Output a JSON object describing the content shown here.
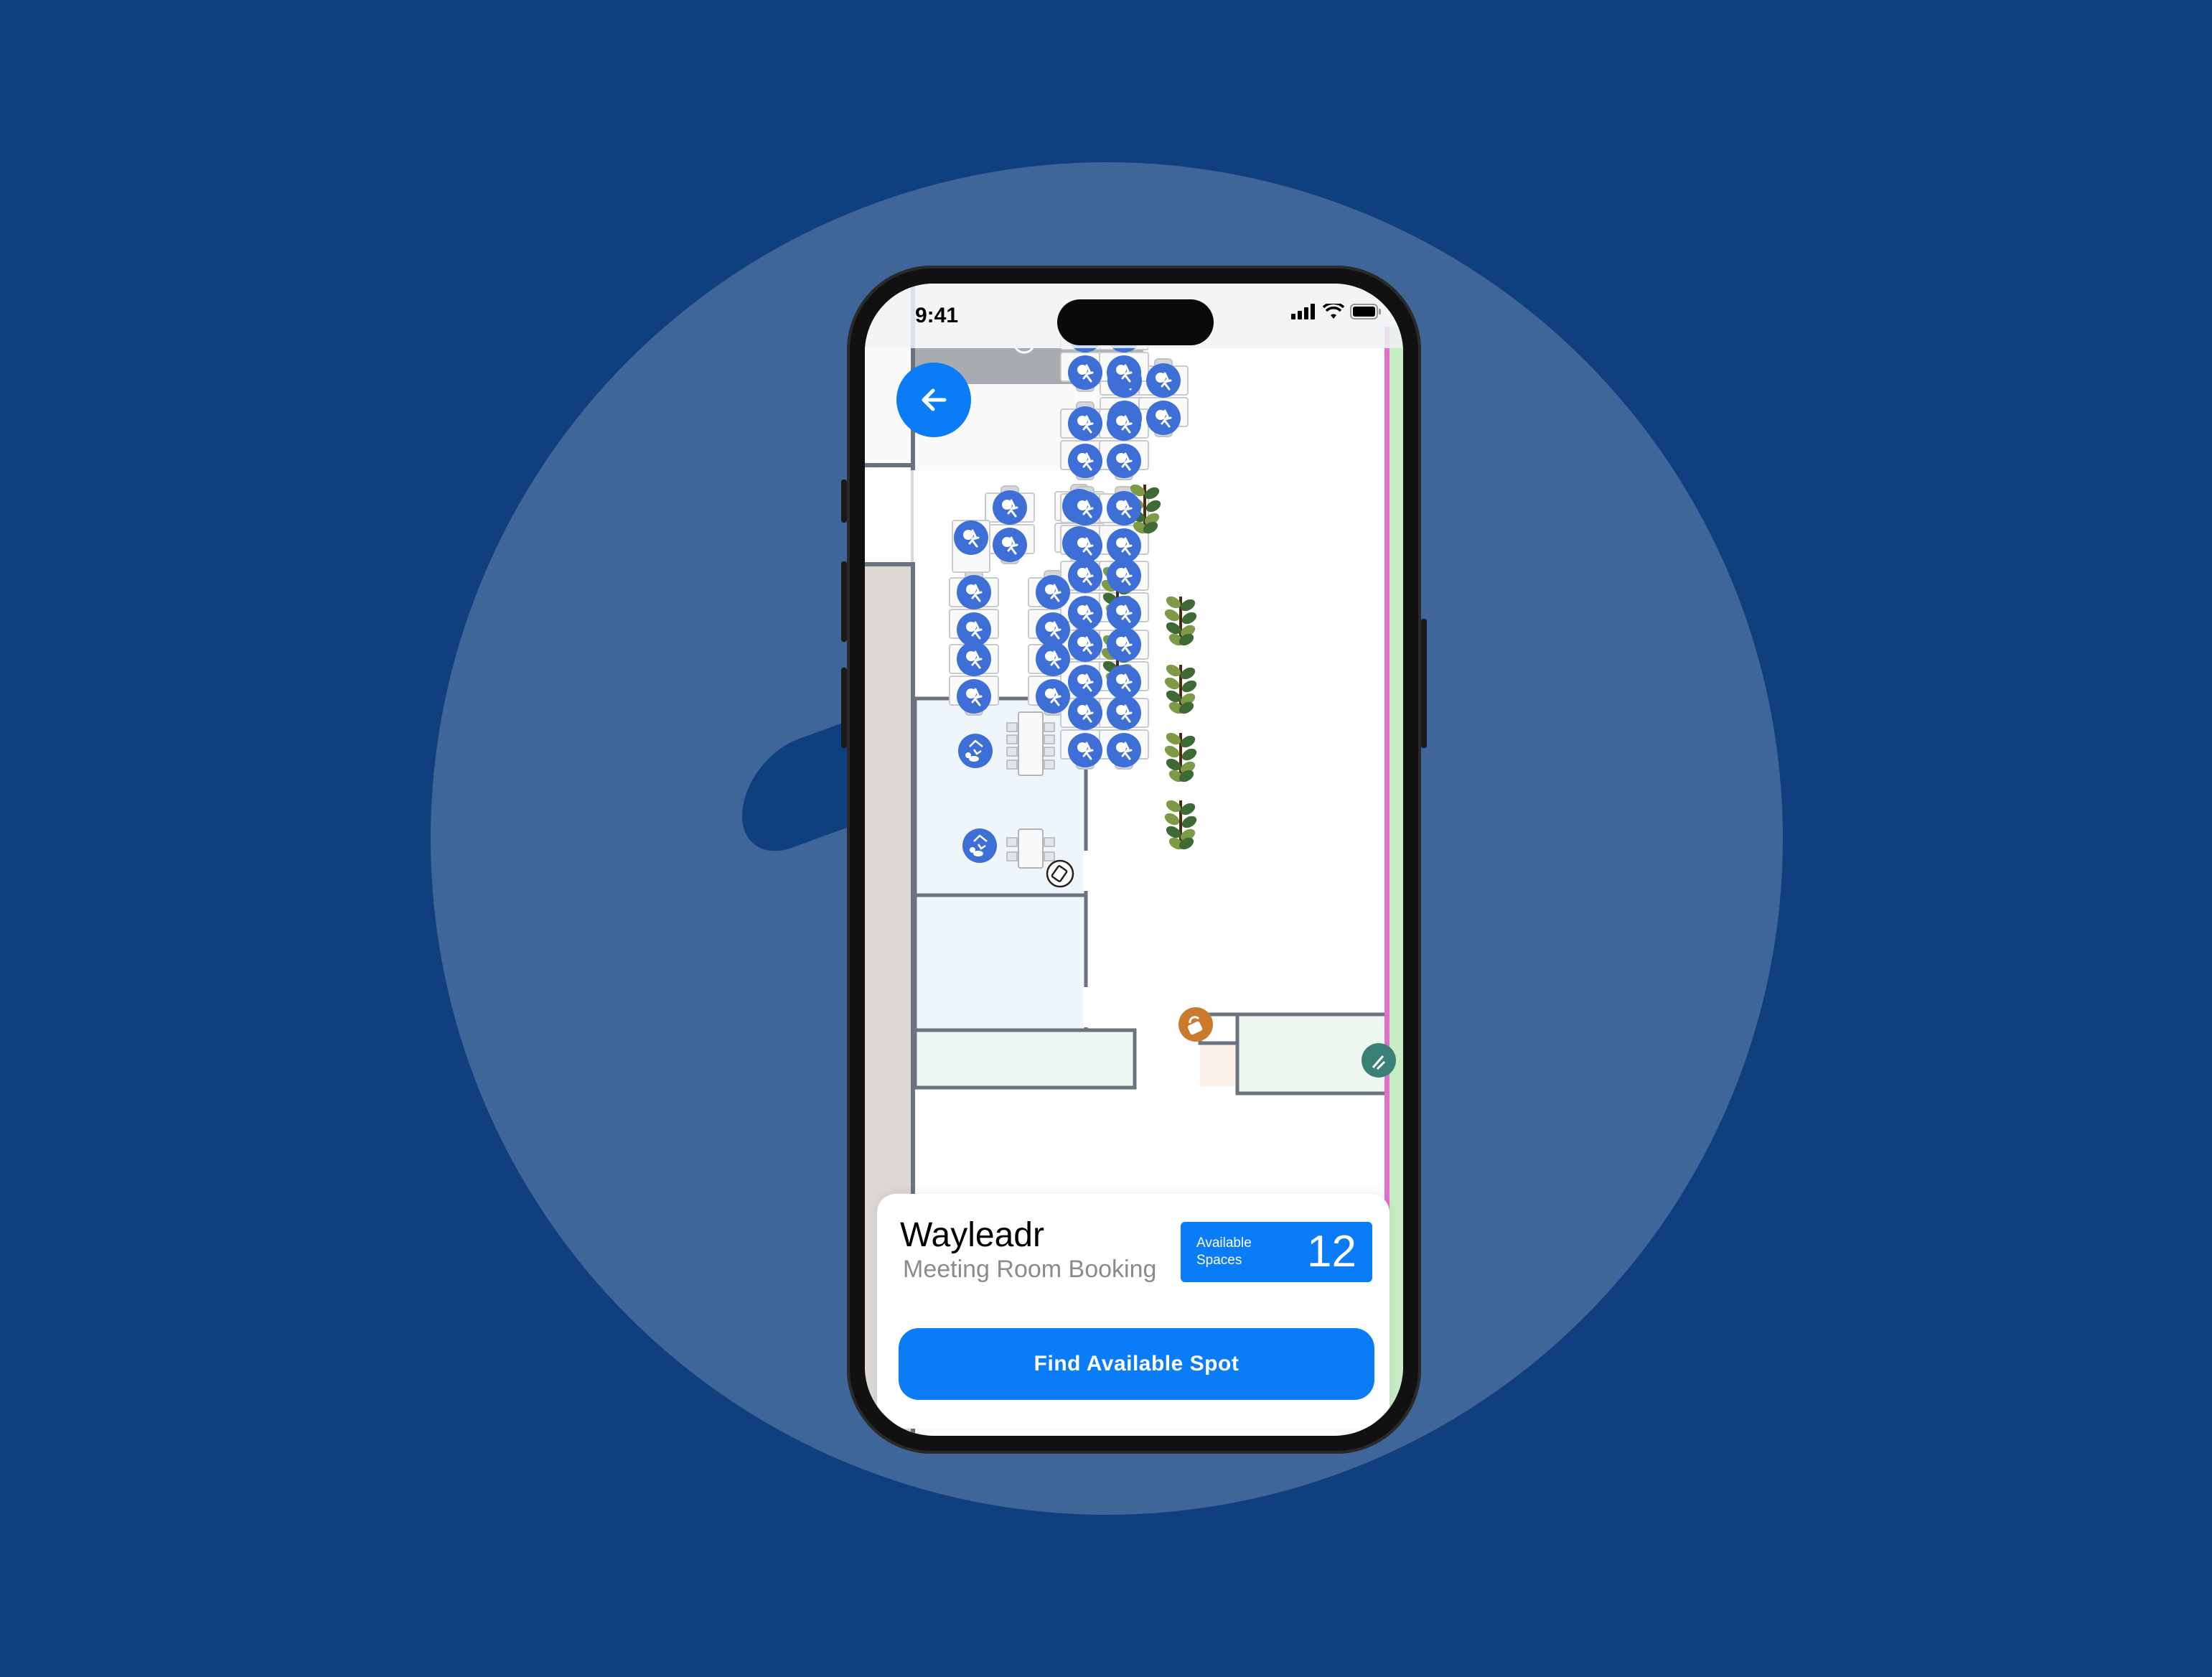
{
  "colors": {
    "page_background": "#0f3f7e",
    "circle_background": "#3f6699",
    "accent": "#0a7cf7",
    "desk_marker": "#3d6fd6",
    "room_fill": "#eef6fb",
    "wall": "#6b7280",
    "green_zone": "#c8ecc4",
    "pink_line": "#e070cc",
    "orange_marker": "#c97a2c",
    "teal_marker": "#3a8077"
  },
  "status_bar": {
    "time": "9:41",
    "icons": [
      "cellular-signal-icon",
      "wifi-icon",
      "battery-icon"
    ]
  },
  "map": {
    "back_button_icon": "arrow-left-icon",
    "desk_marker_icon": "desk-chair-icon",
    "meeting_room_icon": "meeting-room-icon",
    "plant_icon": "plant-icon",
    "other_markers": [
      "tablet-kiosk-icon",
      "lock-icon",
      "teal-room-icon"
    ]
  },
  "card": {
    "title": "Wayleadr",
    "subtitle": "Meeting Room Booking",
    "badge_label": "Available Spaces",
    "badge_value": "12",
    "cta_label": "Find Available Spot"
  }
}
